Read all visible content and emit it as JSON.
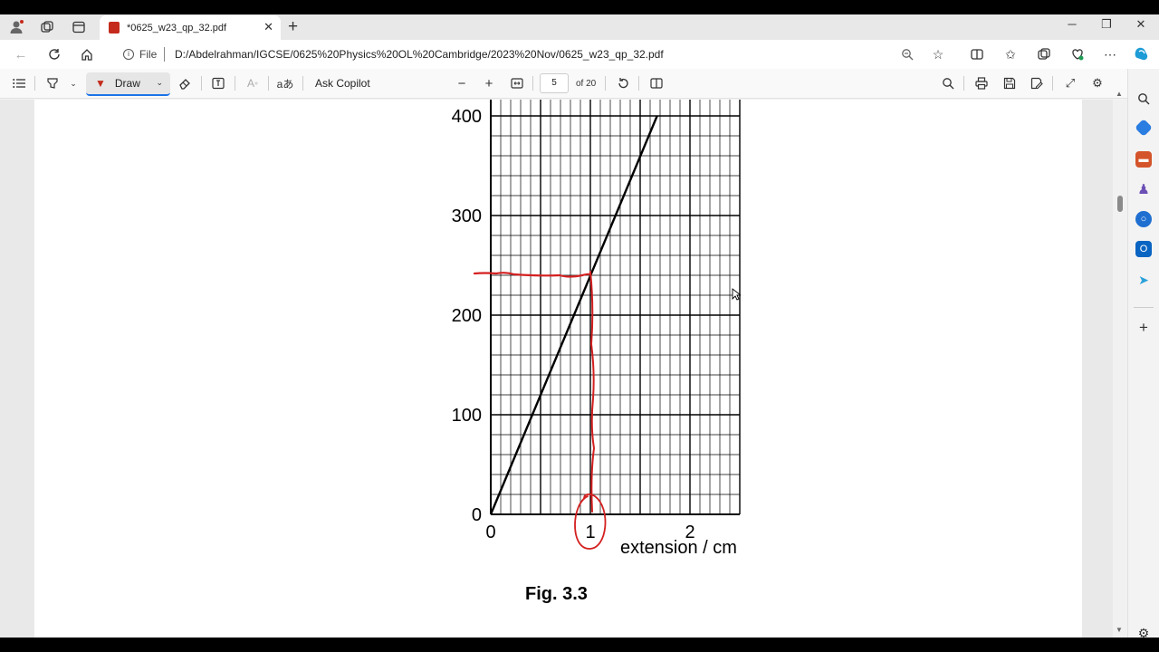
{
  "browser": {
    "tab_title": "*0625_w23_qp_32.pdf",
    "address_prefix": "File",
    "url": "D:/Abdelrahman/IGCSE/0625%20Physics%20OL%20Cambridge/2023%20Nov/0625_w23_qp_32.pdf"
  },
  "pdf_toolbar": {
    "draw_label": "Draw",
    "ask_copilot_label": "Ask Copilot",
    "current_page": "5",
    "page_count_label": "of 20"
  },
  "figure": {
    "caption": "Fig. 3.3",
    "xlabel": "extension / cm",
    "x_ticks": [
      "0",
      "1",
      "2"
    ],
    "y_ticks": [
      "0",
      "100",
      "200",
      "300",
      "400"
    ]
  },
  "chart_data": {
    "type": "line",
    "title": "",
    "xlabel": "extension / cm",
    "ylabel": "",
    "xlim": [
      0,
      2.5
    ],
    "ylim": [
      0,
      400
    ],
    "x_ticks": [
      0,
      1,
      2
    ],
    "y_ticks": [
      0,
      100,
      200,
      300,
      400
    ],
    "grid": true,
    "series": [
      {
        "x": [
          0,
          1.67
        ],
        "y": [
          0,
          400
        ],
        "color": "#000000"
      }
    ],
    "annotations": [
      {
        "type": "handwritten-reading",
        "color": "#d42020",
        "x": 1,
        "y": 240
      }
    ]
  },
  "icons": {
    "tab_pdf": "pdf-icon",
    "annotation_color": "#d42020",
    "accent": "#1a73e8"
  }
}
